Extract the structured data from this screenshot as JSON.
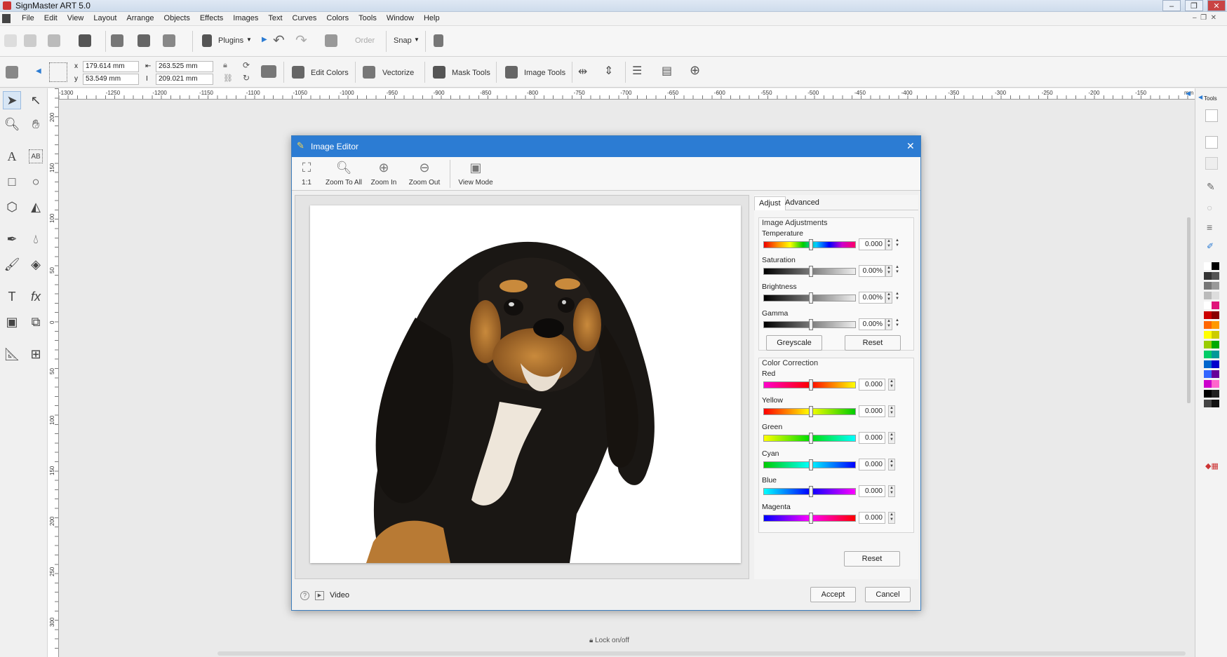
{
  "app": {
    "title": "SignMaster ART 5.0"
  },
  "menu": [
    "File",
    "Edit",
    "View",
    "Layout",
    "Arrange",
    "Objects",
    "Effects",
    "Images",
    "Text",
    "Curves",
    "Colors",
    "Tools",
    "Window",
    "Help"
  ],
  "toolbar1": {
    "plugins": "Plugins",
    "order": "Order",
    "snap": "Snap"
  },
  "toolbar2": {
    "x_label": "x",
    "x_value": "179.614 mm",
    "y_label": "y",
    "y_value": "53.549 mm",
    "w_value": "263.525 mm",
    "h_value": "209.021 mm",
    "edit_colors": "Edit Colors",
    "vectorize": "Vectorize",
    "mask_tools": "Mask Tools",
    "image_tools": "Image Tools"
  },
  "ruler": {
    "h_labels": [
      "-1300",
      "-1250",
      "-1200",
      "-1150",
      "-1100",
      "-1050",
      "-1000",
      "-950",
      "-900",
      "-850",
      "-800",
      "-750",
      "-700",
      "-650",
      "-600",
      "-550",
      "-500",
      "-450",
      "-400",
      "-350",
      "-300",
      "-250",
      "-200",
      "-150"
    ],
    "h_unit": "mm",
    "v_labels": [
      "200",
      "150",
      "100",
      "50",
      "0",
      "50",
      "100",
      "150",
      "200",
      "250",
      "300"
    ],
    "v_unit": "mm"
  },
  "right_panel": {
    "tools_tab": "Tools"
  },
  "dialog": {
    "title": "Image Editor",
    "toolbar": [
      {
        "label": "1:1",
        "icon": "zoom-fit-icon"
      },
      {
        "label": "Zoom To All",
        "icon": "zoom-all-icon"
      },
      {
        "label": "Zoom In",
        "icon": "zoom-in-icon"
      },
      {
        "label": "Zoom Out",
        "icon": "zoom-out-icon"
      },
      {
        "label": "View Mode",
        "icon": "view-mode-icon"
      }
    ],
    "tabs": {
      "adjust": "Adjust",
      "advanced": "Advanced"
    },
    "image_adjustments": {
      "title": "Image Adjustments",
      "temperature": {
        "label": "Temperature",
        "value": "0.000"
      },
      "saturation": {
        "label": "Saturation",
        "value": "0.00%"
      },
      "brightness": {
        "label": "Brightness",
        "value": "0.00%"
      },
      "gamma": {
        "label": "Gamma",
        "value": "0.00%"
      },
      "greyscale": "Greyscale",
      "reset": "Reset"
    },
    "color_correction": {
      "title": "Color Correction",
      "red": {
        "label": "Red",
        "value": "0.000"
      },
      "yellow": {
        "label": "Yellow",
        "value": "0.000"
      },
      "green": {
        "label": "Green",
        "value": "0.000"
      },
      "cyan": {
        "label": "Cyan",
        "value": "0.000"
      },
      "blue": {
        "label": "Blue",
        "value": "0.000"
      },
      "magenta": {
        "label": "Magenta",
        "value": "0.000"
      },
      "reset": "Reset"
    },
    "footer": {
      "video": "Video",
      "accept": "Accept",
      "cancel": "Cancel"
    }
  },
  "status": {
    "lock": "Lock on/off"
  },
  "colors": {
    "accent": "#2c7cd3"
  }
}
